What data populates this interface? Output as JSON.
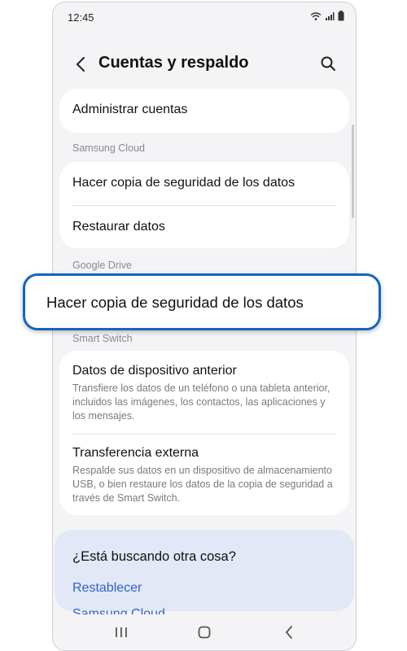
{
  "status_bar": {
    "time": "12:45"
  },
  "header": {
    "title": "Cuentas y respaldo"
  },
  "accounts": {
    "manage_label": "Administrar cuentas"
  },
  "samsung_cloud": {
    "section_label": "Samsung Cloud",
    "backup_label": "Hacer copia de seguridad de los datos",
    "restore_label": "Restaurar datos"
  },
  "google_drive": {
    "section_label": "Google Drive",
    "backup_label": "Hacer copia de seguridad de los datos"
  },
  "smart_switch": {
    "section_label": "Smart Switch",
    "previous_device": {
      "title": "Datos de dispositivo anterior",
      "description": "Transfiere los datos de un teléfono o una tableta anterior, incluidos las imágenes, los contactos, las aplicaciones y los mensajes."
    },
    "external_transfer": {
      "title": "Transferencia externa",
      "description": "Respalde sus datos en un dispositivo de almacenamiento USB, o bien restaure los datos de la copia de seguridad a través de Smart Switch."
    }
  },
  "help": {
    "title": "¿Está buscando otra cosa?",
    "links": [
      "Restablecer",
      "Samsung Cloud"
    ]
  },
  "colors": {
    "accent": "#1565c0",
    "link": "#2f63c8",
    "background": "#f4f4f6"
  },
  "icons": [
    "wifi-icon",
    "signal-icon",
    "battery-icon",
    "back-arrow-icon",
    "search-icon",
    "recent-apps-icon",
    "home-icon",
    "back-nav-icon"
  ]
}
